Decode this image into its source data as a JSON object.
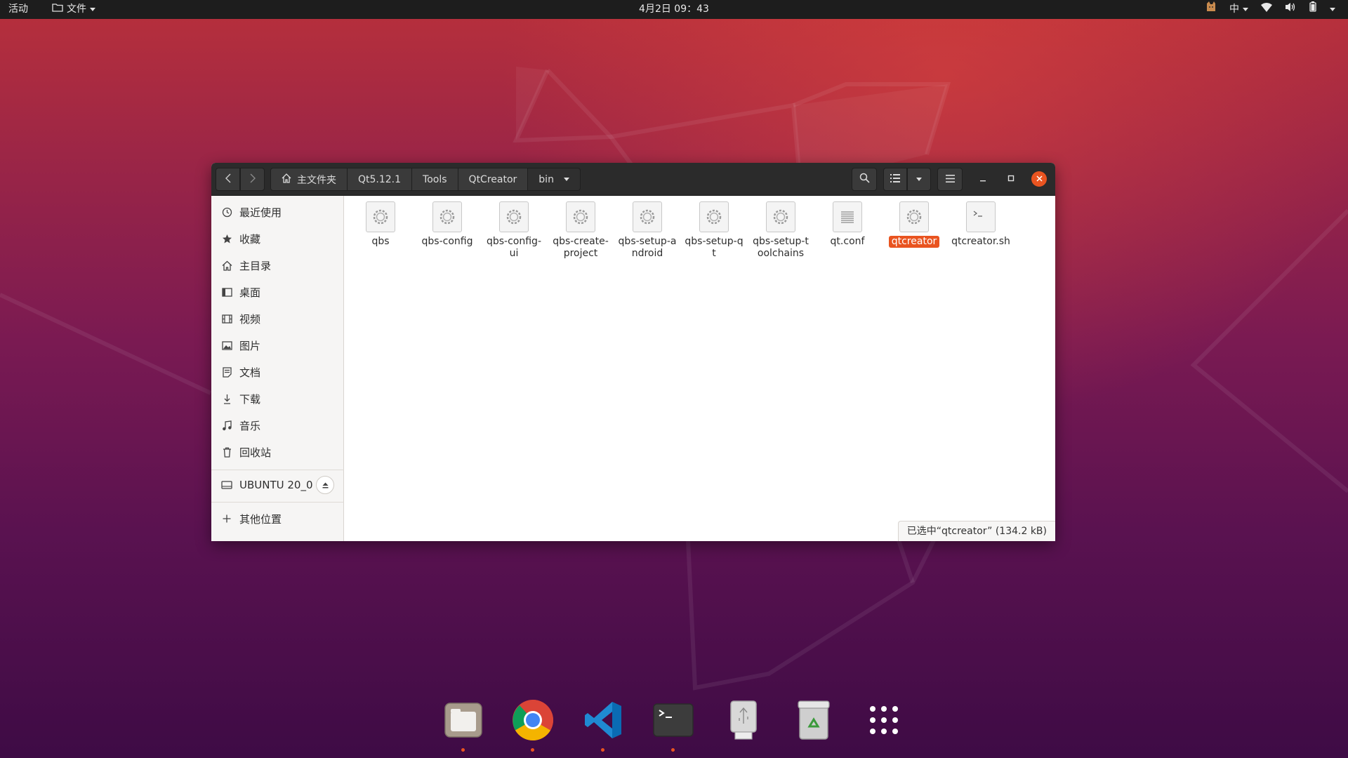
{
  "topbar": {
    "activities": "活动",
    "app_menu": "文件",
    "clock": "4月2日 09：43",
    "input_method": "中"
  },
  "window": {
    "pathbar": [
      {
        "label": "主文件夹",
        "icon": "home-icon"
      },
      {
        "label": "Qt5.12.1"
      },
      {
        "label": "Tools"
      },
      {
        "label": "QtCreator"
      },
      {
        "label": "bin"
      }
    ],
    "sidebar": {
      "items": [
        {
          "label": "最近使用",
          "icon": "recent-icon"
        },
        {
          "label": "收藏",
          "icon": "star-icon"
        },
        {
          "label": "主目录",
          "icon": "home-icon"
        },
        {
          "label": "桌面",
          "icon": "desktop-icon"
        },
        {
          "label": "视频",
          "icon": "video-icon"
        },
        {
          "label": "图片",
          "icon": "picture-icon"
        },
        {
          "label": "文档",
          "icon": "document-icon"
        },
        {
          "label": "下载",
          "icon": "download-icon"
        },
        {
          "label": "音乐",
          "icon": "music-icon"
        },
        {
          "label": "回收站",
          "icon": "trash-icon"
        }
      ],
      "device": {
        "label": "UBUNTU 20_0",
        "icon": "drive-icon"
      },
      "other": {
        "label": "其他位置",
        "icon": "plus-icon"
      }
    },
    "files": [
      {
        "name": "qbs",
        "type": "executable"
      },
      {
        "name": "qbs-config",
        "type": "executable"
      },
      {
        "name": "qbs-config-ui",
        "type": "executable"
      },
      {
        "name": "qbs-create-project",
        "type": "executable"
      },
      {
        "name": "qbs-setup-android",
        "type": "executable"
      },
      {
        "name": "qbs-setup-qt",
        "type": "executable"
      },
      {
        "name": "qbs-setup-toolchains",
        "type": "executable"
      },
      {
        "name": "qt.conf",
        "type": "text"
      },
      {
        "name": "qtcreator",
        "type": "executable",
        "selected": true
      },
      {
        "name": "qtcreator.sh",
        "type": "script"
      }
    ],
    "status": "已选中“qtcreator” (134.2 kB)"
  },
  "dock": [
    {
      "name": "files",
      "icon": "files-app-icon",
      "running": true
    },
    {
      "name": "chrome",
      "icon": "chrome-icon",
      "running": true
    },
    {
      "name": "vscode",
      "icon": "vscode-icon",
      "running": true
    },
    {
      "name": "terminal",
      "icon": "terminal-icon",
      "running": true
    },
    {
      "name": "usb",
      "icon": "usb-drive-icon",
      "running": false
    },
    {
      "name": "trash",
      "icon": "trash-dock-icon",
      "running": false
    },
    {
      "name": "apps",
      "icon": "app-grid-icon",
      "running": false
    }
  ],
  "colors": {
    "accent": "#e95420",
    "headerbar": "#2b2b2b",
    "topbar": "#1d1d1d"
  }
}
